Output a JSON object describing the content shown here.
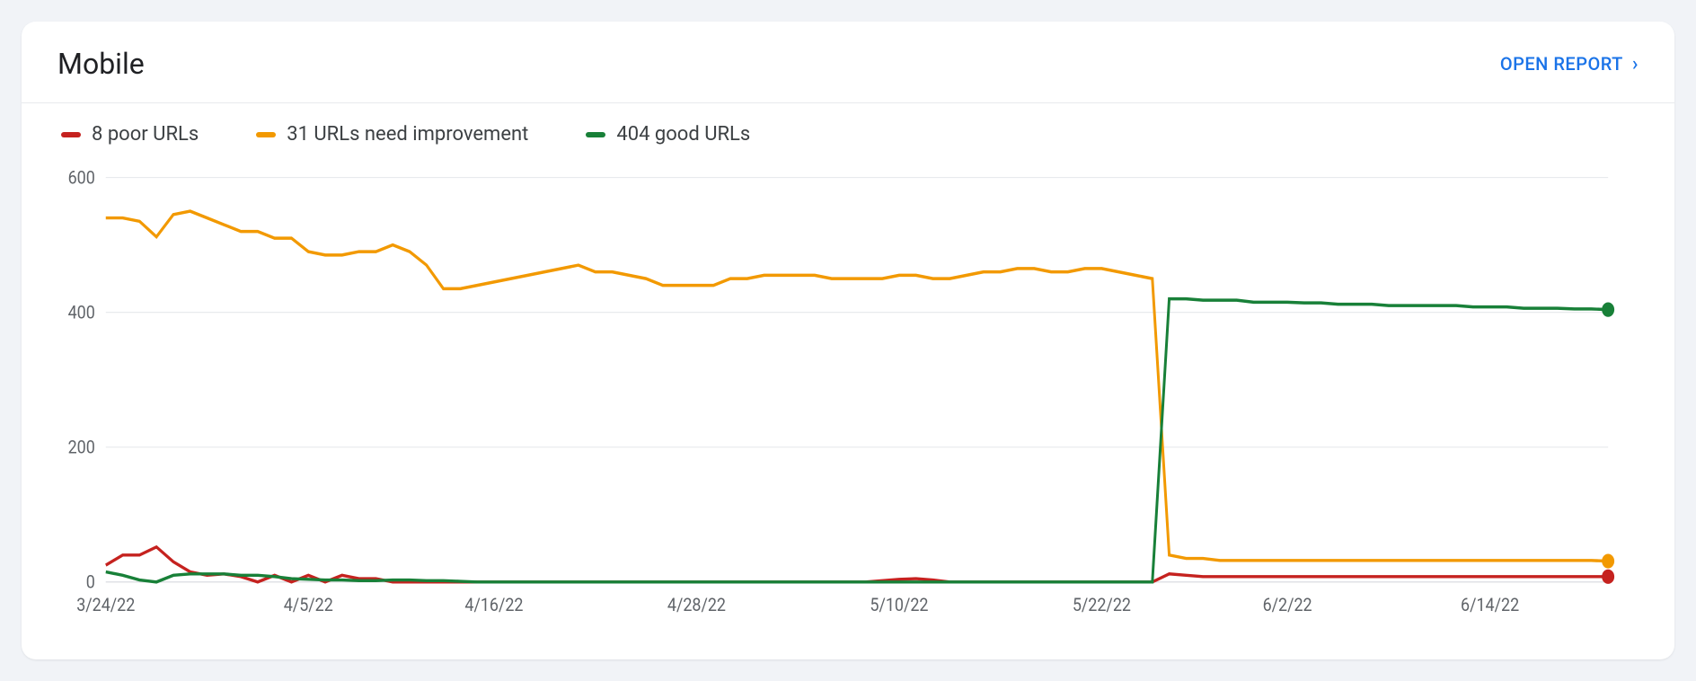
{
  "header": {
    "title": "Mobile",
    "open_report_label": "OPEN REPORT"
  },
  "colors": {
    "poor": "#c5221f",
    "improve": "#f29900",
    "good": "#188038",
    "grid": "#e8eaed",
    "axis": "#dadce0",
    "tick_text": "#5f6368"
  },
  "legend": [
    {
      "key": "poor",
      "label": "8 poor URLs",
      "swatch_style": "background:#c5221f"
    },
    {
      "key": "improve",
      "label": "31 URLs need improvement",
      "swatch_style": "background:#f29900"
    },
    {
      "key": "good",
      "label": "404 good URLs",
      "swatch_style": "background:#188038"
    }
  ],
  "chart_data": {
    "type": "line",
    "title": "Mobile",
    "xlabel": "",
    "ylabel": "",
    "ylim": [
      0,
      600
    ],
    "y_ticks": [
      0,
      200,
      400,
      600
    ],
    "n_days": 90,
    "x_tick_positions": [
      0,
      12,
      23,
      35,
      47,
      59,
      70,
      82
    ],
    "x_tick_labels": [
      "3/24/22",
      "4/5/22",
      "4/16/22",
      "4/28/22",
      "5/10/22",
      "5/22/22",
      "6/2/22",
      "6/14/22"
    ],
    "series": [
      {
        "name": "poor URLs",
        "color": "#c5221f",
        "values": [
          25,
          40,
          40,
          52,
          30,
          15,
          10,
          12,
          8,
          0,
          10,
          0,
          10,
          0,
          10,
          5,
          5,
          0,
          0,
          0,
          0,
          0,
          0,
          0,
          0,
          0,
          0,
          0,
          0,
          0,
          0,
          0,
          0,
          0,
          0,
          0,
          0,
          0,
          0,
          0,
          0,
          0,
          0,
          0,
          0,
          0,
          2,
          4,
          5,
          3,
          0,
          0,
          0,
          0,
          0,
          0,
          0,
          0,
          0,
          0,
          0,
          0,
          0,
          12,
          10,
          8,
          8,
          8,
          8,
          8,
          8,
          8,
          8,
          8,
          8,
          8,
          8,
          8,
          8,
          8,
          8,
          8,
          8,
          8,
          8,
          8,
          8,
          8,
          8,
          8
        ]
      },
      {
        "name": "URLs need improvement",
        "color": "#f29900",
        "values": [
          540,
          540,
          535,
          512,
          545,
          550,
          540,
          530,
          520,
          520,
          510,
          510,
          490,
          485,
          485,
          490,
          490,
          500,
          490,
          470,
          435,
          435,
          440,
          445,
          450,
          455,
          460,
          465,
          470,
          460,
          460,
          455,
          450,
          440,
          440,
          440,
          440,
          450,
          450,
          455,
          455,
          455,
          455,
          450,
          450,
          450,
          450,
          455,
          455,
          450,
          450,
          455,
          460,
          460,
          465,
          465,
          460,
          460,
          465,
          465,
          460,
          455,
          450,
          40,
          35,
          35,
          32,
          32,
          32,
          32,
          32,
          32,
          32,
          32,
          32,
          32,
          32,
          32,
          32,
          32,
          32,
          32,
          32,
          32,
          32,
          32,
          32,
          32,
          32,
          31
        ]
      },
      {
        "name": "good URLs",
        "color": "#188038",
        "values": [
          15,
          10,
          3,
          0,
          10,
          12,
          12,
          12,
          10,
          10,
          8,
          5,
          4,
          3,
          3,
          2,
          2,
          3,
          3,
          2,
          2,
          1,
          0,
          0,
          0,
          0,
          0,
          0,
          0,
          0,
          0,
          0,
          0,
          0,
          0,
          0,
          0,
          0,
          0,
          0,
          0,
          0,
          0,
          0,
          0,
          0,
          0,
          0,
          0,
          0,
          0,
          0,
          0,
          0,
          0,
          0,
          0,
          0,
          0,
          0,
          0,
          0,
          0,
          420,
          420,
          418,
          418,
          418,
          415,
          415,
          415,
          414,
          414,
          412,
          412,
          412,
          410,
          410,
          410,
          410,
          410,
          408,
          408,
          408,
          406,
          406,
          406,
          405,
          405,
          404
        ]
      }
    ]
  }
}
